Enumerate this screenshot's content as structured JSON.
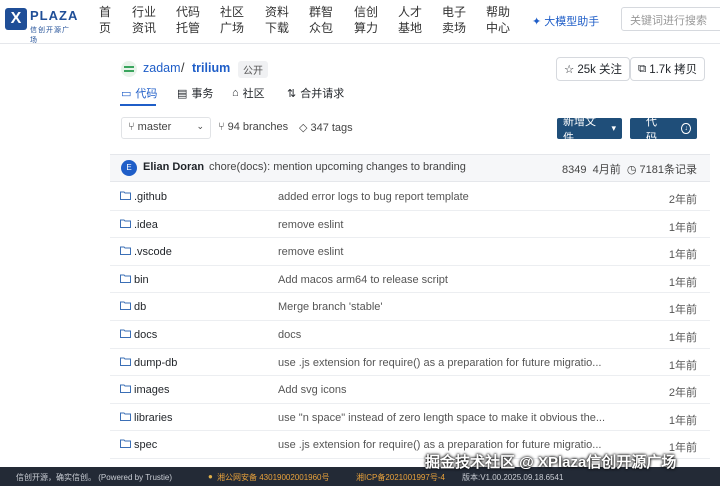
{
  "topnav": {
    "logo_text": "PLAZA",
    "logo_sub": "信创开源广场",
    "items": [
      {
        "line1": "首",
        "line2": "页"
      },
      {
        "line1": "行业",
        "line2": "资讯"
      },
      {
        "line1": "代码",
        "line2": "托管"
      },
      {
        "line1": "社区",
        "line2": "广场"
      },
      {
        "line1": "资料",
        "line2": "下载"
      },
      {
        "line1": "群智",
        "line2": "众包"
      },
      {
        "line1": "信创",
        "line2": "算力"
      },
      {
        "line1": "人才",
        "line2": "基地"
      },
      {
        "line1": "电子",
        "line2": "卖场"
      },
      {
        "line1": "帮助",
        "line2": "中心"
      }
    ],
    "ai_label": "大模型助手",
    "search_placeholder": "关键词进行搜索"
  },
  "repo": {
    "owner": "zadam",
    "slash": "/",
    "name": "trilium",
    "visibility": "公开",
    "star_label": "25k 关注",
    "fork_label": "1.7k 拷贝",
    "tabs": [
      {
        "label": "代码",
        "icon": "book-icon"
      },
      {
        "label": "事务",
        "icon": "issue-icon"
      },
      {
        "label": "社区",
        "icon": "community-icon"
      },
      {
        "label": "合并请求",
        "icon": "pull-request-icon"
      }
    ]
  },
  "toolbar": {
    "branch": "master",
    "branches": "94 branches",
    "tags": "347 tags",
    "new_file": "新增文件",
    "code": "代码"
  },
  "commit": {
    "author": "Elian Doran",
    "message": "chore(docs): mention upcoming changes to branding",
    "hash": "8349",
    "time": "4月前",
    "count": "7181条记录"
  },
  "files": [
    {
      "name": ".github",
      "message": "added error logs to bug report template",
      "time": "2年前"
    },
    {
      "name": ".idea",
      "message": "remove eslint",
      "time": "1年前"
    },
    {
      "name": ".vscode",
      "message": "remove eslint",
      "time": "1年前"
    },
    {
      "name": "bin",
      "message": "Add macos arm64 to release script",
      "time": "1年前"
    },
    {
      "name": "db",
      "message": "Merge branch 'stable'",
      "time": "1年前"
    },
    {
      "name": "docs",
      "message": "docs",
      "time": "1年前"
    },
    {
      "name": "dump-db",
      "message": "use .js extension for require() as a preparation for future migratio...",
      "time": "1年前"
    },
    {
      "name": "images",
      "message": "Add svg icons",
      "time": "2年前"
    },
    {
      "name": "libraries",
      "message": "use \"n space\" instead of zero length space to make it obvious the...",
      "time": "1年前"
    },
    {
      "name": "spec",
      "message": "use .js extension for require() as a preparation for future migratio...",
      "time": "1年前"
    }
  ],
  "footer": {
    "slogan": "信创开源，确实信创。 (Powered by Trustie)",
    "police": "湘公网安备 43019002001960号",
    "icp": "湘ICP备2021001997号-4",
    "version": "版本:V1.00.2025.09.18.6541"
  },
  "watermark": "掘金技术社区 @ XPlaza信创开源广场"
}
